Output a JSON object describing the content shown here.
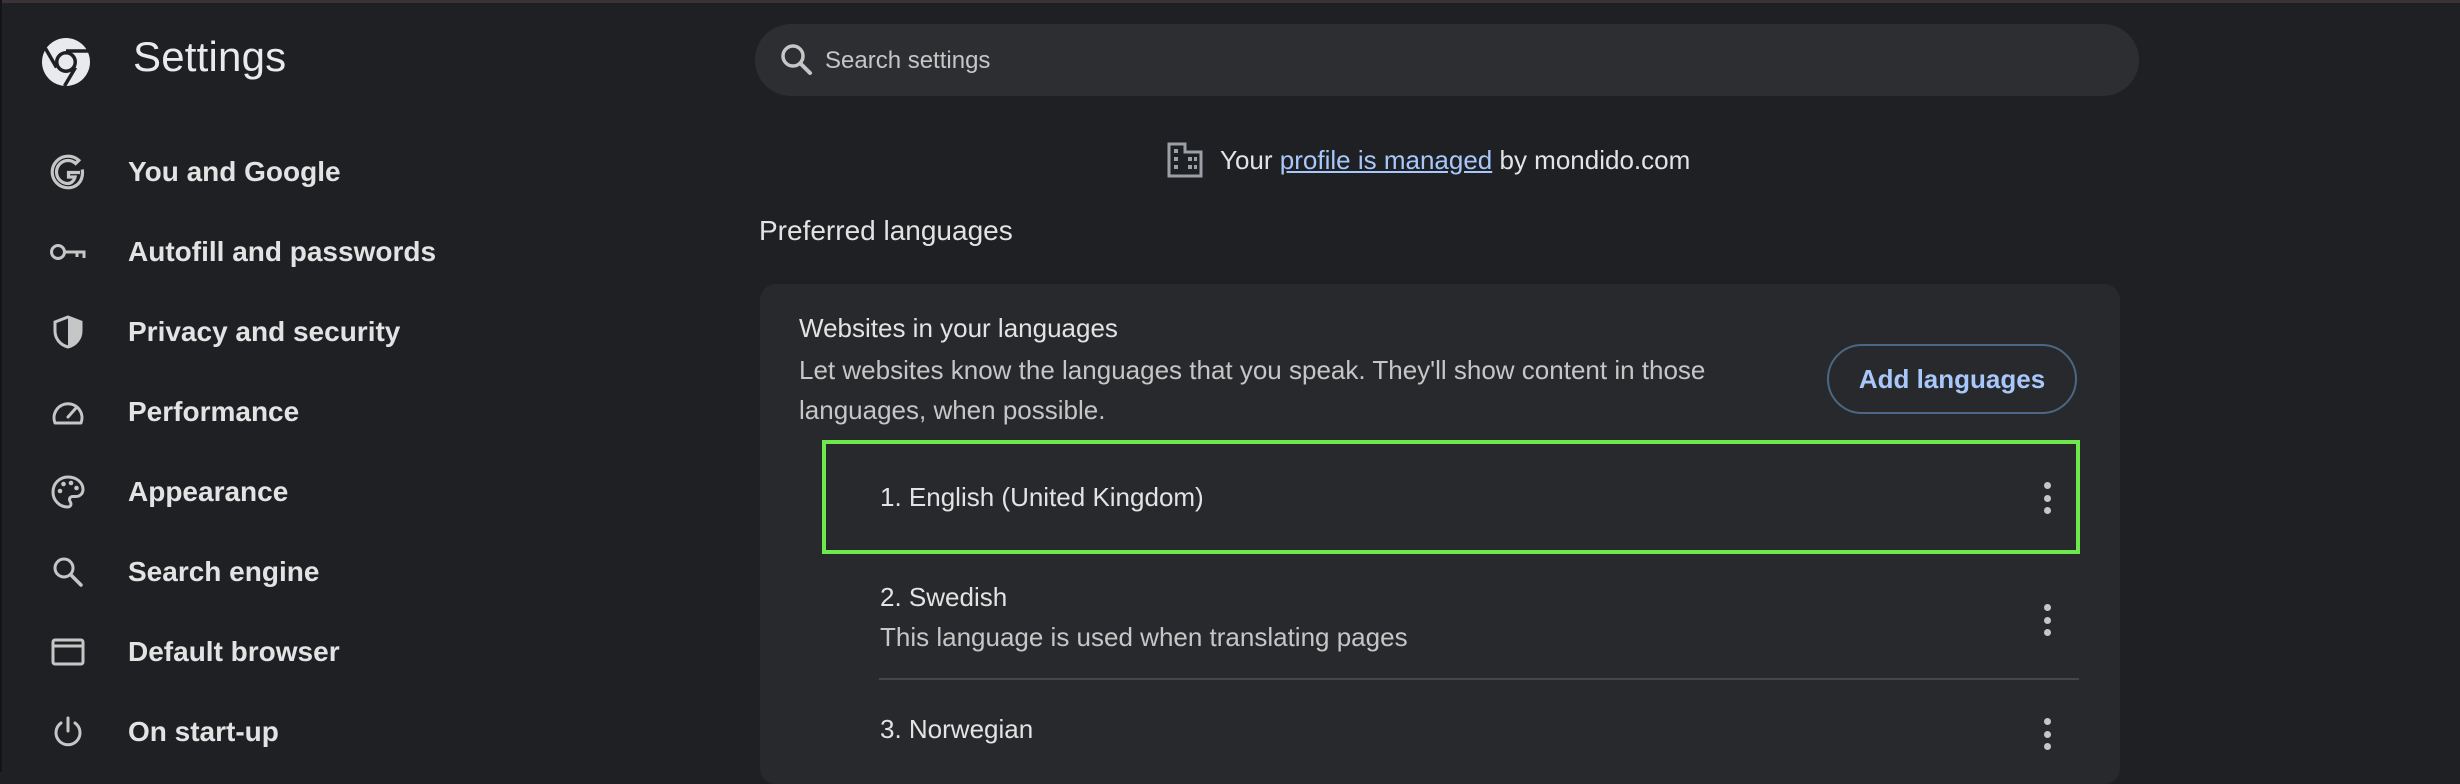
{
  "header": {
    "title": "Settings",
    "search_placeholder": "Search settings"
  },
  "sidebar": {
    "items": [
      {
        "label": "You and Google",
        "icon": "google-g-icon"
      },
      {
        "label": "Autofill and passwords",
        "icon": "key-icon"
      },
      {
        "label": "Privacy and security",
        "icon": "shield-icon"
      },
      {
        "label": "Performance",
        "icon": "speedometer-icon"
      },
      {
        "label": "Appearance",
        "icon": "palette-icon"
      },
      {
        "label": "Search engine",
        "icon": "search-icon"
      },
      {
        "label": "Default browser",
        "icon": "browser-window-icon"
      },
      {
        "label": "On start-up",
        "icon": "power-icon"
      }
    ]
  },
  "managed": {
    "prefix": "Your",
    "link": "profile is managed",
    "suffix": "by mondido.com"
  },
  "section": {
    "title": "Preferred languages"
  },
  "card": {
    "title": "Websites in your languages",
    "description": "Let websites know the languages that you speak. They'll show content in those languages, when possible.",
    "add_button": "Add languages"
  },
  "languages": [
    {
      "name": "1. English (United Kingdom)",
      "note": ""
    },
    {
      "name": "2. Swedish",
      "note": "This language is used when translating pages"
    },
    {
      "name": "3. Norwegian",
      "note": ""
    }
  ],
  "colors": {
    "background": "#1f2023",
    "card": "#28292c",
    "accent": "#a8c7fa",
    "highlight": "#6fe84d"
  }
}
